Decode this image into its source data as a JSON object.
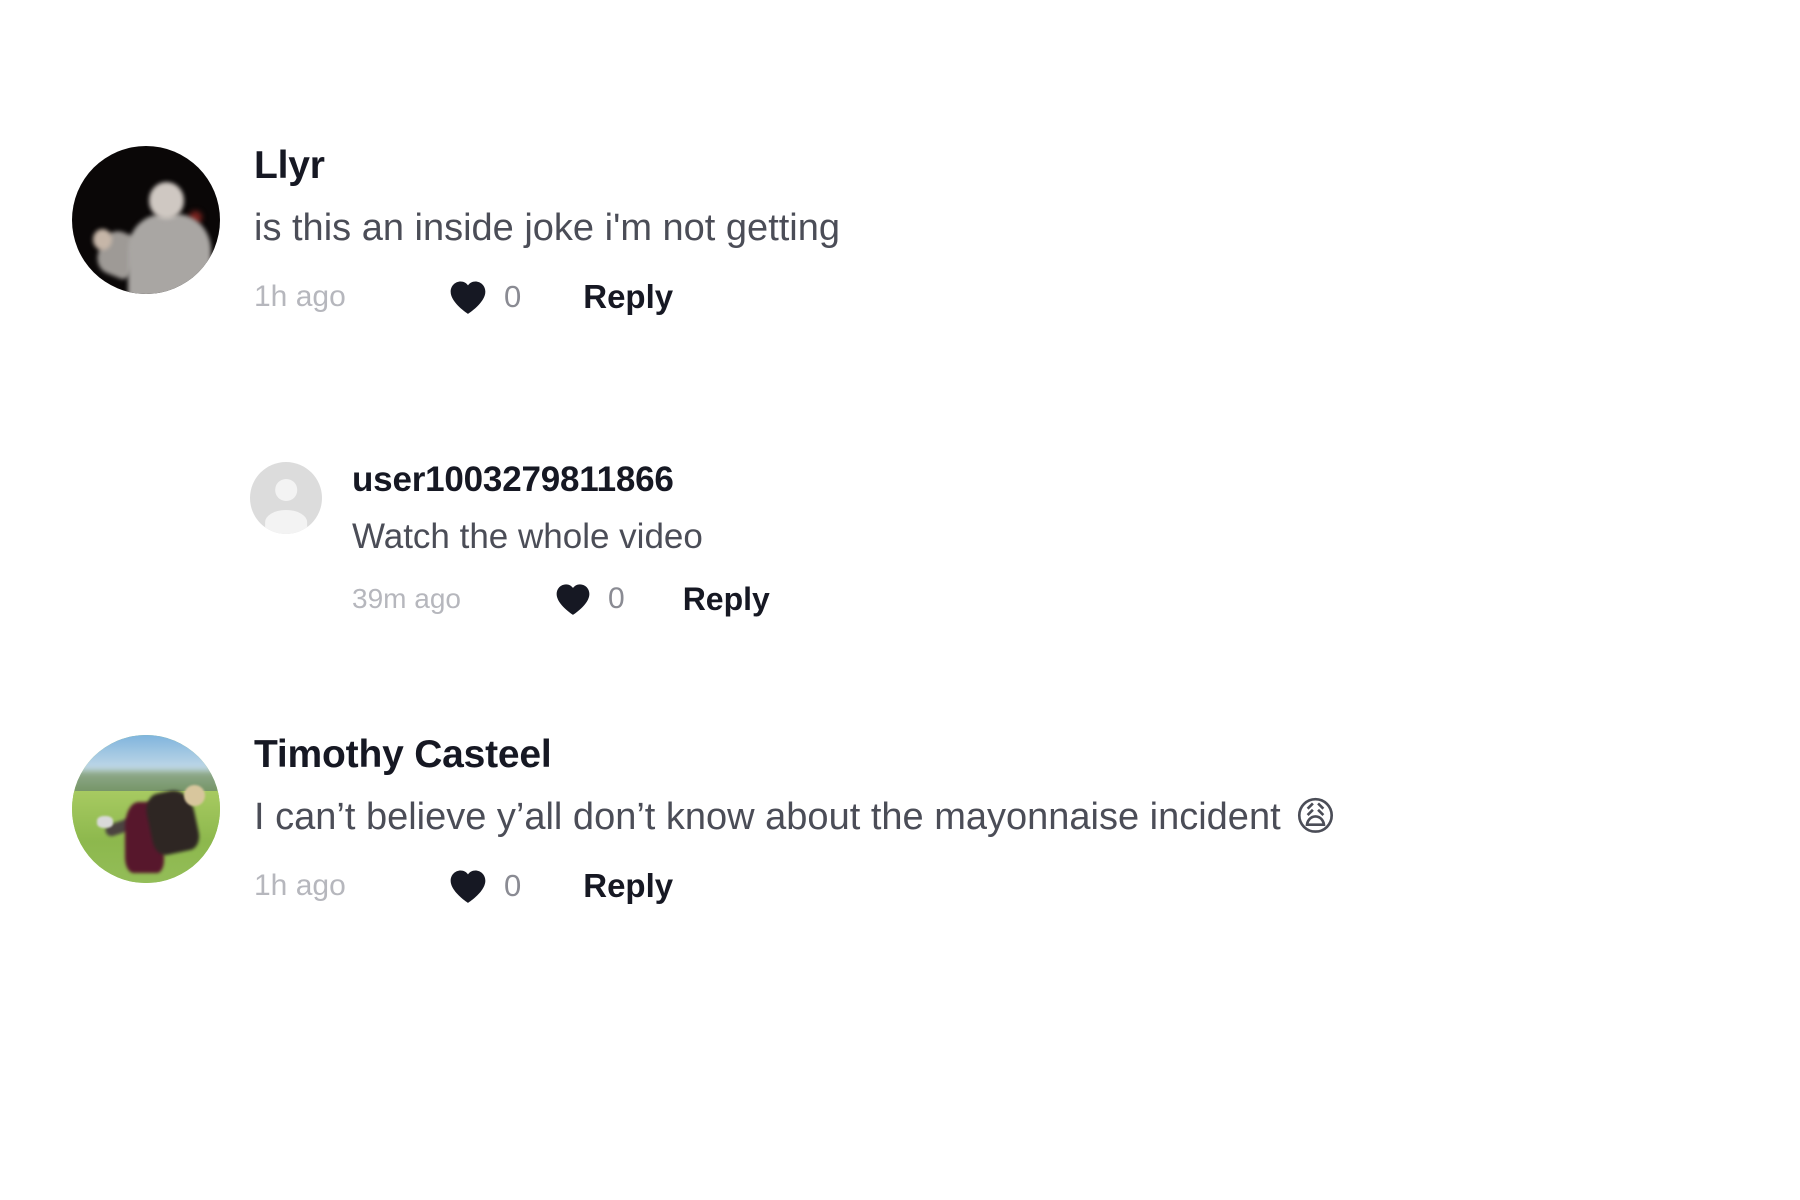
{
  "panel": {
    "name": "tiktok-comment-list",
    "background": "#ffffff",
    "accent_text_color": "#161823",
    "secondary_text_color": "#4b4d57",
    "timestamp_color": "#b6b7bd"
  },
  "comments": [
    {
      "username": "Llyr",
      "text": "is this an inside joke i'm not getting",
      "emoji": "",
      "timestamp": "1h ago",
      "like_count": "0",
      "reply_label": "Reply",
      "avatar": "photo-dark-person-grey-hoodie",
      "level": "top"
    },
    {
      "username": "user1003279811866",
      "text": "Watch the whole video",
      "emoji": "",
      "timestamp": "39m ago",
      "like_count": "0",
      "reply_label": "Reply",
      "avatar": "default-user-avatar",
      "level": "reply"
    },
    {
      "username": "Timothy Casteel",
      "text": "I can’t believe y’all don’t know about the mayonnaise incident",
      "emoji": "😩",
      "timestamp": "1h ago",
      "like_count": "0",
      "reply_label": "Reply",
      "avatar": "photo-outdoor-field-couple",
      "level": "top"
    }
  ]
}
